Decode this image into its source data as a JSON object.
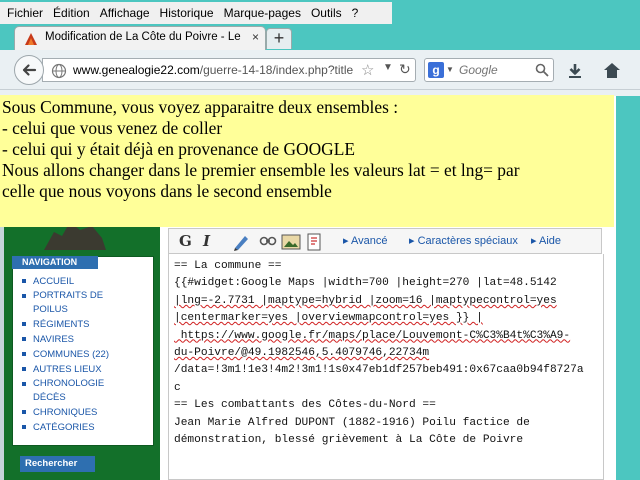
{
  "menu": [
    "Fichier",
    "Édition",
    "Affichage",
    "Historique",
    "Marque-pages",
    "Outils",
    "?"
  ],
  "tab": {
    "title": "Modification de La Côte du Poivre - Les ...",
    "close": "×",
    "new_tab": "+"
  },
  "toolbar": {
    "url_host": "www.genealogie22.com",
    "url_path": "/guerre-14-18/index.php?title",
    "search_placeholder": "Google"
  },
  "callout": {
    "lines": [
      "Sous Commune, vous voyez apparaitre deux ensembles :",
      "- celui que vous venez de coller",
      "- celui qui y était déjà en provenance de GOOGLE",
      "Nous allons changer dans le premier ensemble les valeurs lat = et lng= par",
      "celle que nous voyons dans le second ensemble"
    ]
  },
  "sidebar": {
    "nav_title": "NAVIGATION",
    "items": [
      "ACCUEIL",
      "PORTRAITS DE POILUS",
      "RÉGIMENTS",
      "NAVIRES",
      "COMMUNES (22)",
      "AUTRES LIEUX",
      "CHRONOLOGIE DÉCÈS",
      "CHRONIQUES",
      "CATÉGORIES"
    ],
    "search_title": "Rechercher"
  },
  "editor_toolbar": {
    "bold": "G",
    "italic": "I",
    "advanced": "Avancé",
    "special_chars": "Caractères spéciaux",
    "help": "Aide"
  },
  "editor_lines": [
    "== La commune ==",
    "{{#widget:Google Maps |width=700 |height=270 |lat=48.5142",
    "|lng=-2.7731 |maptype=hybrid |zoom=16 |maptypecontrol=yes",
    "|centermarker=yes |overviewmapcontrol=yes }} |",
    " https://www.google.fr/maps/place/Louvemont-C%C3%B4t%C3%A9-",
    "du-Poivre/@49.1982546,5.4079746,22734m",
    "/data=!3m1!1e3!4m2!3m1!1s0x47eb1df257beb491:0x67caa0b94f8727a",
    "c",
    "== Les combattants des Côtes-du-Nord ==",
    "Jean Marie Alfred DUPONT (1882-1916) Poilu factice de",
    "démonstration, blessé grièvement à La Côte de Poivre"
  ]
}
